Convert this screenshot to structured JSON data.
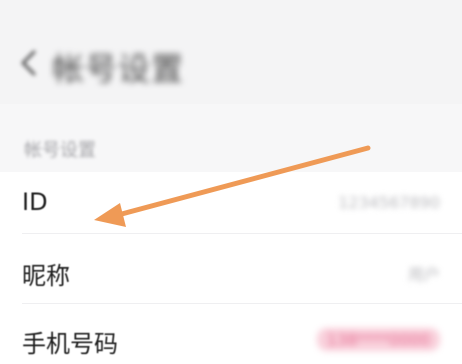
{
  "header": {
    "back_icon": "chevron-left-icon",
    "title": "帐号设置"
  },
  "section": {
    "label": "帐号设置"
  },
  "rows": [
    {
      "label": "ID",
      "value": "1234567890"
    },
    {
      "label": "昵称",
      "value": "用户"
    },
    {
      "label": "手机号码",
      "value": "138****0000"
    }
  ],
  "colors": {
    "annotation_arrow": "#ef9a56",
    "accent_pink": "#e5698f"
  }
}
